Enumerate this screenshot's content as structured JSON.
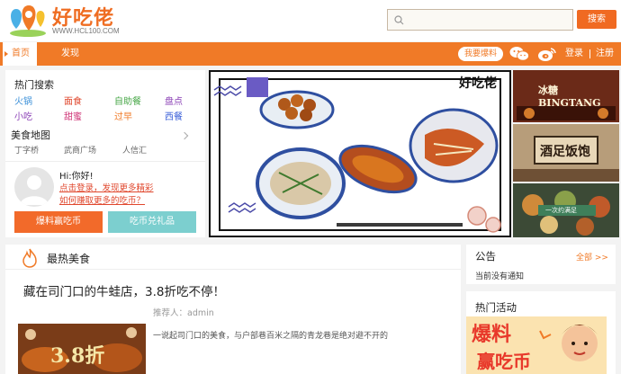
{
  "header": {
    "logo_text": "好吃佬",
    "logo_url": "WWW.HCL100.COM",
    "search_placeholder": "",
    "search_button": "搜索"
  },
  "nav": {
    "home": "首页",
    "discover": "发现",
    "report": "我要爆料",
    "login": "登录",
    "register": "注册"
  },
  "left": {
    "hot_search_title": "热门搜索",
    "hot_tags": [
      {
        "label": "火锅",
        "color": "#3a8fd8"
      },
      {
        "label": "面食",
        "color": "#e0472d"
      },
      {
        "label": "自助餐",
        "color": "#4aa84a"
      },
      {
        "label": "盘点",
        "color": "#8a3fb5"
      },
      {
        "label": "小吃",
        "color": "#8a3fb5"
      },
      {
        "label": "甜蜜",
        "color": "#d03a7a"
      },
      {
        "label": "过早",
        "color": "#f07a27"
      },
      {
        "label": "西餐",
        "color": "#3a5fd8"
      }
    ],
    "food_map_title": "美食地图",
    "map_items": [
      "丁字桥",
      "武商广场",
      "人信汇"
    ],
    "greeting": "Hi:你好!",
    "login_link_1": "点击登录，发现更多精彩",
    "login_link_2": "如何赚取更多的吃币？",
    "btn_report_coin": "爆料赢吃币",
    "btn_exchange": "吃币兑礼品"
  },
  "banner": {
    "brand": "好吃佬"
  },
  "thumbs": {
    "t1": "冰糖BINGTANG",
    "t2": "酒足饭饱",
    "t3": "一次约满足"
  },
  "hot": {
    "title": "最热美食",
    "article_title": "藏在司门口的牛蛙店，3.8折吃不停！",
    "author": "推荐人：admin",
    "summary": "一说起司门口的美食，与户部巷百米之隔的青龙巷是绝对避不开的",
    "thumb_text": "3.8折"
  },
  "notice": {
    "title": "公告",
    "all": "全部 >>",
    "text": "当前没有通知"
  },
  "activity": {
    "title": "热门活动",
    "banner_text": "爆料",
    "banner_text2": "赢吃币"
  },
  "colors": {
    "brand": "#f07a27",
    "btn_orange": "#f26a2a",
    "btn_teal": "#7ccfcf"
  }
}
